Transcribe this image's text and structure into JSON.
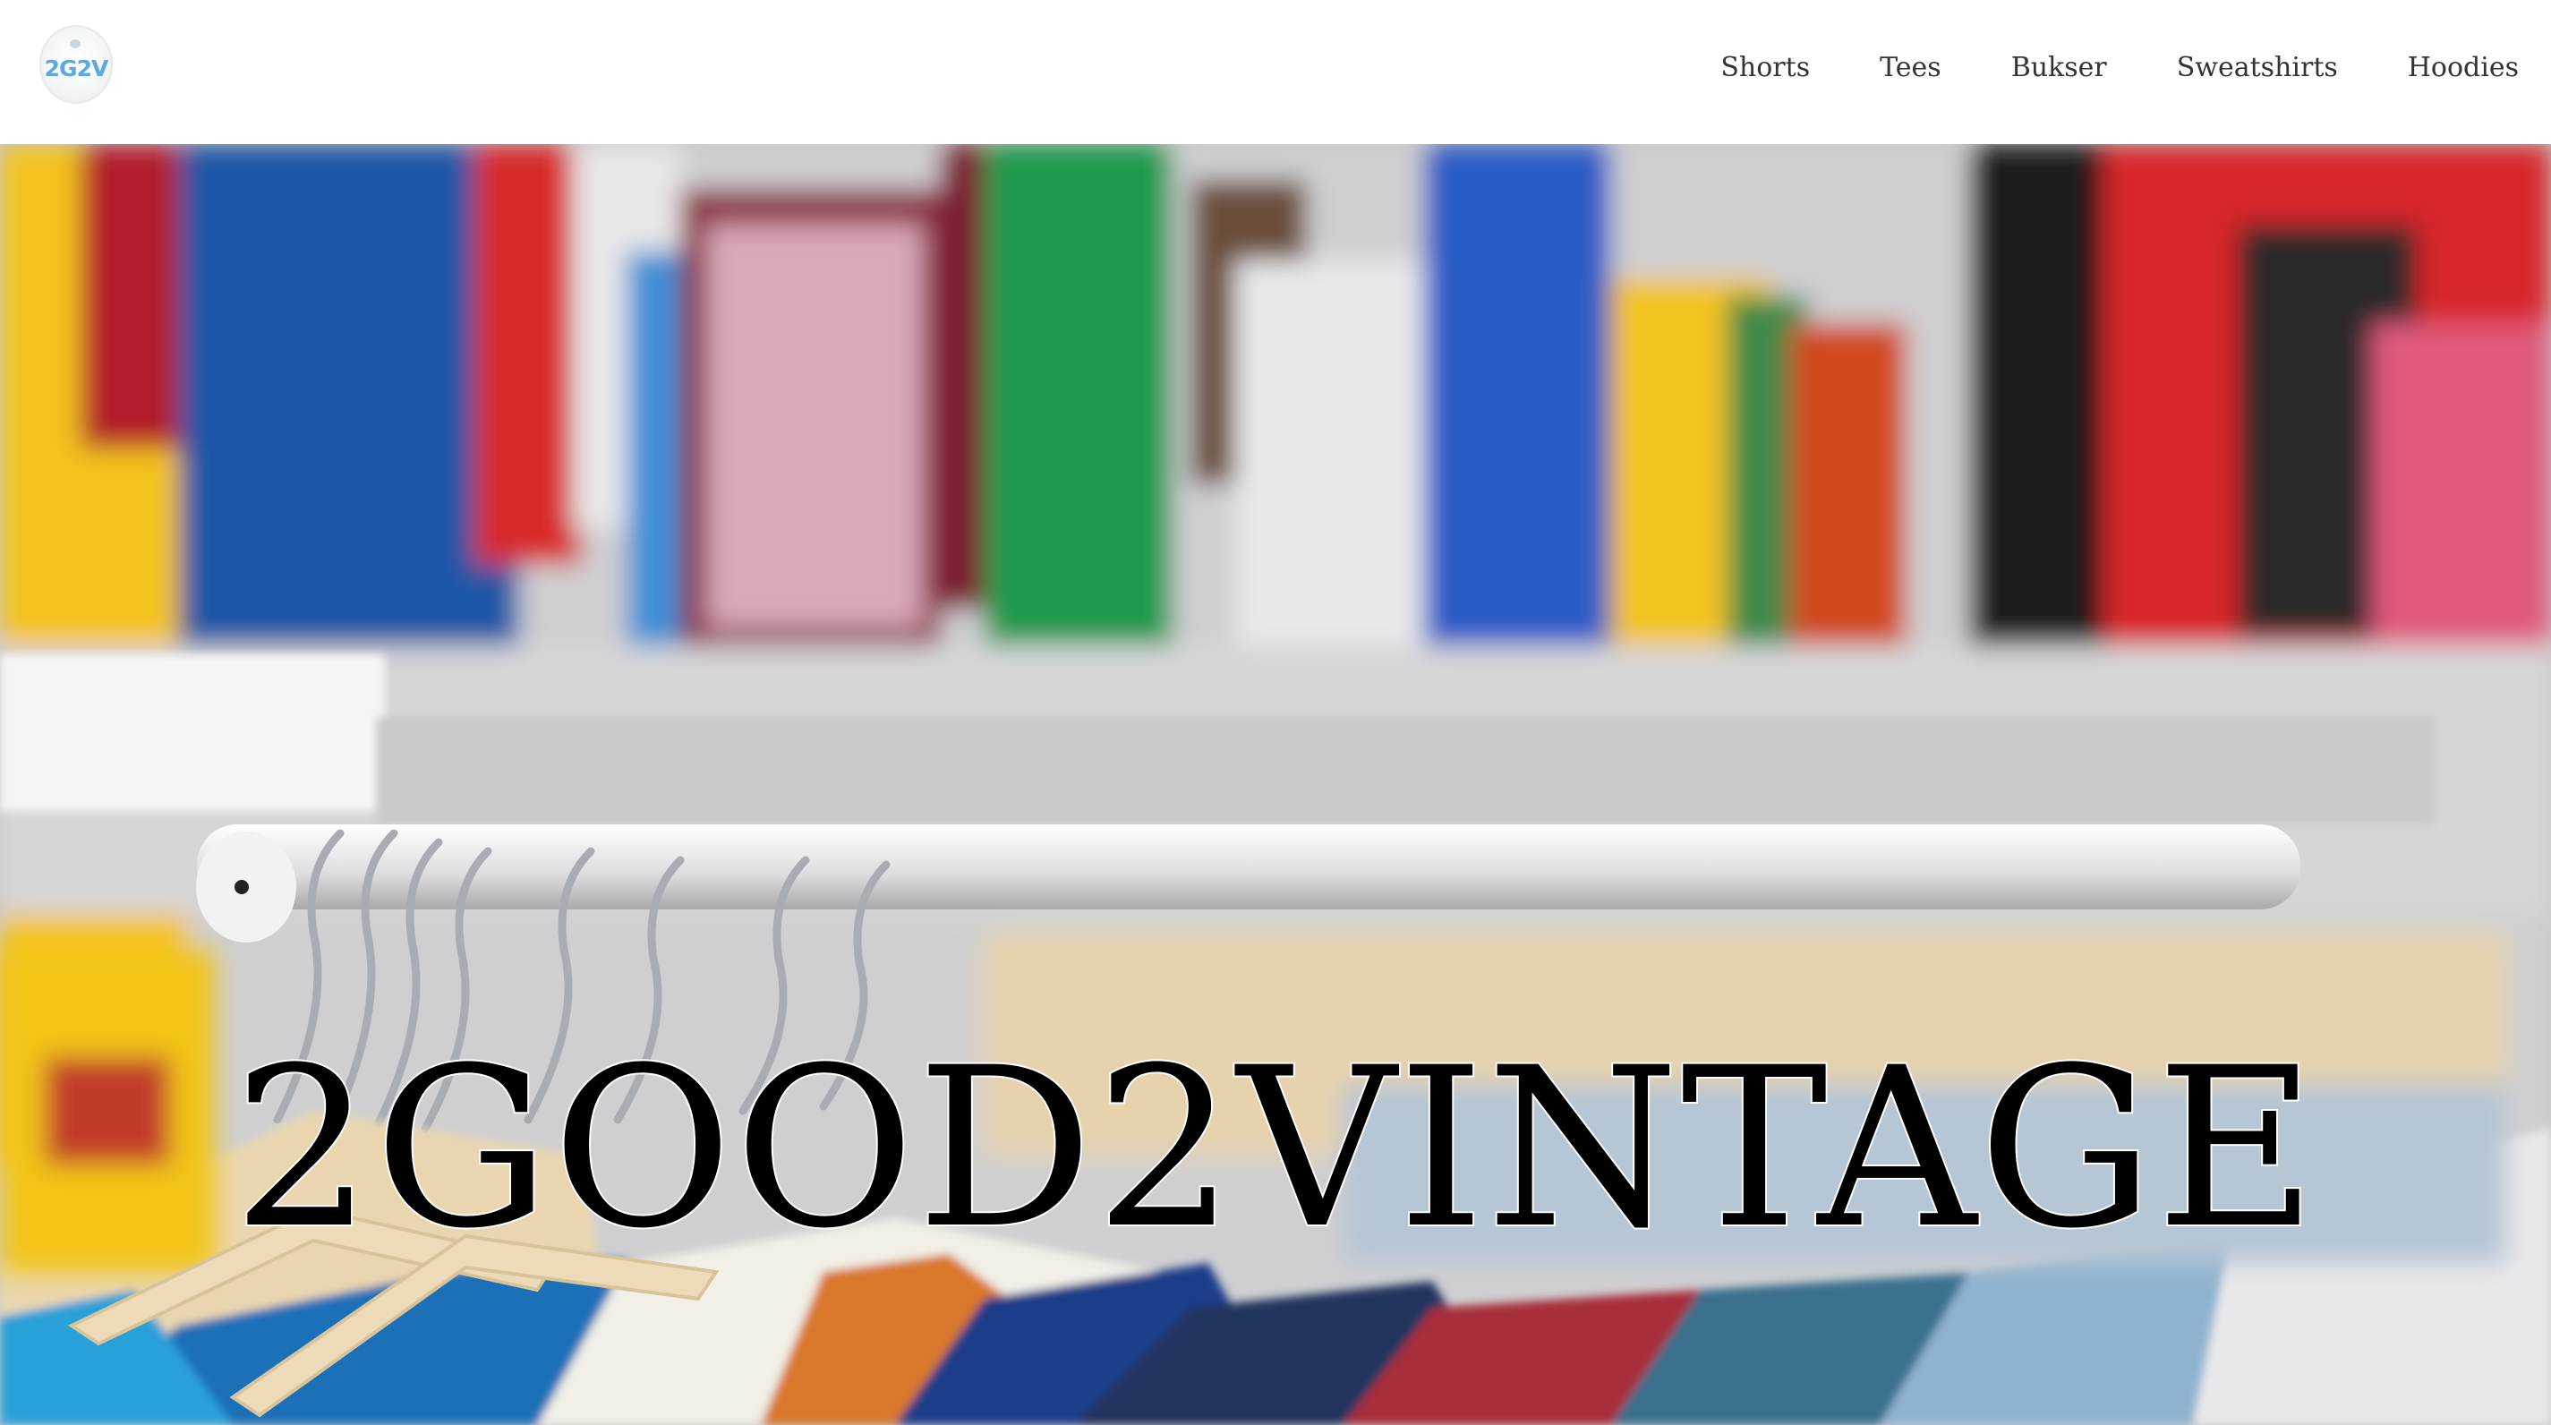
{
  "header": {
    "logo_text": "2G2V",
    "nav": [
      {
        "label": "Shorts"
      },
      {
        "label": "Tees"
      },
      {
        "label": "Bukser"
      },
      {
        "label": "Sweatshirts"
      },
      {
        "label": "Hoodies"
      }
    ]
  },
  "hero": {
    "title": "2GOOD2VINTAGE",
    "image": "blurred clothing rack with wooden hangers and colorful vintage shirts"
  },
  "colors": {
    "header_bg": "#ffffff",
    "nav_text": "#333333",
    "logo_accent": "#5aa9e0",
    "title_text": "#000000",
    "title_outline": "#ffffff"
  },
  "icons": {
    "logo": "2g2v-logo-icon"
  }
}
